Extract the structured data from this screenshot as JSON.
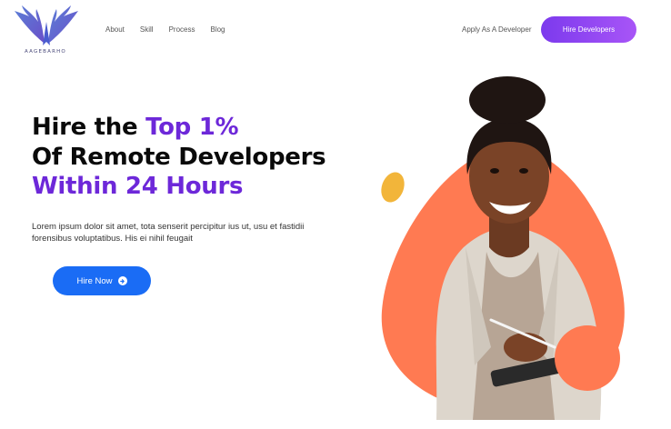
{
  "brand": {
    "name": "AAGEBARHO"
  },
  "nav": {
    "items": [
      {
        "label": "About"
      },
      {
        "label": "Skill"
      },
      {
        "label": "Process"
      },
      {
        "label": "Blog"
      }
    ],
    "apply_label": "Apply As A Developer",
    "hire_developers_label": "Hire Developers"
  },
  "hero": {
    "line1_prefix": "Hire the ",
    "line1_accent": "Top 1%",
    "line2": "Of Remote Developers",
    "line3": "Within 24 Hours",
    "description": "Lorem ipsum dolor sit amet, tota senserit percipitur ius ut, usu et fastidii forensibus voluptatibus. His ei nihil feugait",
    "cta_label": "Hire Now",
    "cta_icon": "arrow-right-circle-icon"
  },
  "colors": {
    "accent_purple": "#6d28d9",
    "cta_blue": "#1a6cf5",
    "blob_orange": "#ff7a52",
    "dot_yellow": "#f2b53a"
  }
}
